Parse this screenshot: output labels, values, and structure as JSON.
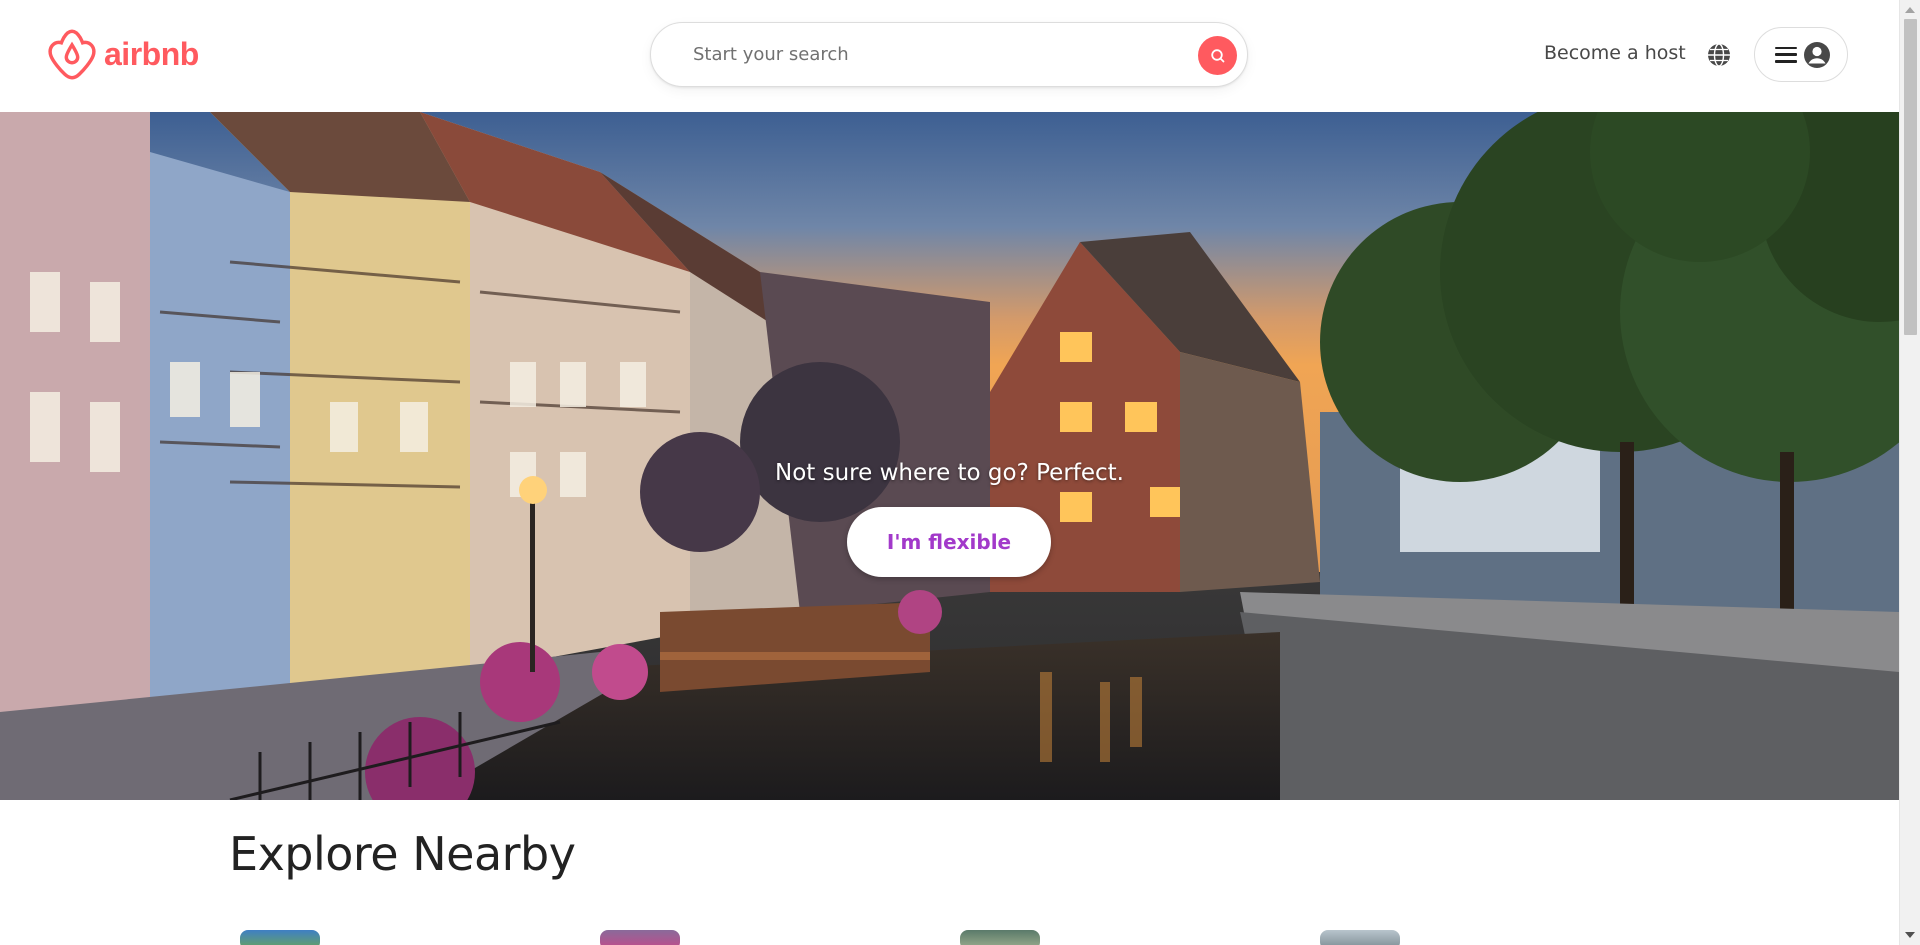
{
  "header": {
    "logo_text": "airbnb",
    "search": {
      "placeholder": "Start your search"
    },
    "become_host_label": "Become a host",
    "icons": {
      "logo": "airbnb-logo-icon",
      "search": "search-icon",
      "globe": "globe-icon",
      "menu": "hamburger-menu-icon",
      "avatar": "user-avatar-icon"
    }
  },
  "hero": {
    "tagline": "Not sure where to go? Perfect.",
    "cta_label": "I'm flexible"
  },
  "explore": {
    "title": "Explore Nearby"
  },
  "colors": {
    "brand": "#ff5a5f",
    "cta_text": "#a239ca",
    "text_primary": "#222222",
    "text_secondary": "#484848"
  }
}
